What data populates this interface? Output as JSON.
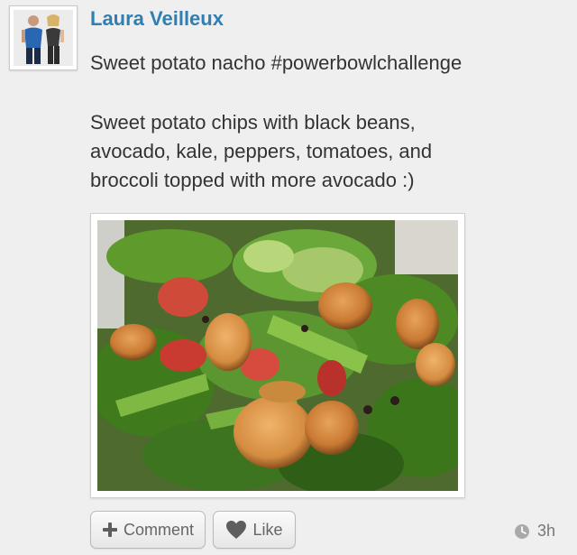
{
  "post": {
    "author": "Laura Veilleux",
    "title": "Sweet potato nacho #powerbowlchallenge",
    "body_lines": [
      "Sweet potato chips with black beans,",
      "avocado, kale, peppers, tomatoes, and",
      "broccoli topped with more avocado :)"
    ],
    "time": "3h"
  },
  "actions": {
    "comment_label": "Comment",
    "like_label": "Like"
  },
  "icons": {
    "comment": "plus-icon",
    "like": "heart-icon",
    "time": "clock-icon"
  },
  "colors": {
    "author": "#2f7fb5",
    "text": "#333333",
    "background": "#efefef"
  }
}
